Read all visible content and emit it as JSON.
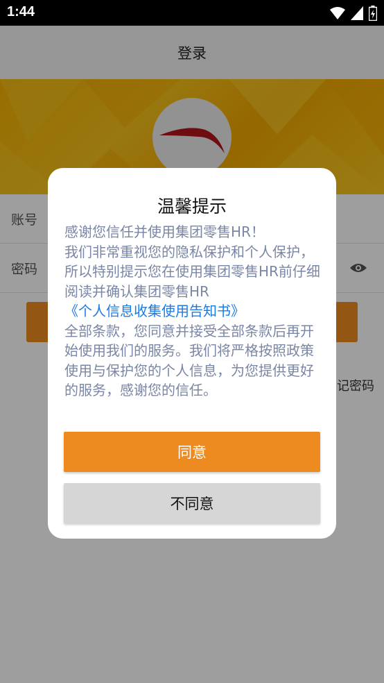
{
  "status_bar": {
    "time": "1:44"
  },
  "app_bar": {
    "title": "登录"
  },
  "form": {
    "account_label": "账号",
    "password_label": "密码",
    "forgot_label": "记密码"
  },
  "dialog": {
    "title": "温馨提示",
    "para1": "感谢您信任并使用集团零售HR！",
    "para2": "我们非常重视您的隐私保护和个人保护，所以特别提示您在使用集团零售HR前仔细阅读并确认集团零售HR",
    "link": "《个人信息收集使用告知书》",
    "para3": "全部条款，您同意并接受全部条款后再开始使用我们的服务。我们将严格按照政策使用与保护您的个人信息，为您提供更好的服务，感谢您的信任。",
    "agree_label": "同意",
    "disagree_label": "不同意"
  },
  "colors": {
    "accent": "#ee8b20",
    "link": "#1a7be6",
    "body_text": "#7a86a6",
    "logo_red": "#b3141c"
  },
  "icons": [
    "wifi-icon",
    "signal-icon",
    "battery-icon",
    "eye-icon",
    "brand-logo-icon"
  ]
}
